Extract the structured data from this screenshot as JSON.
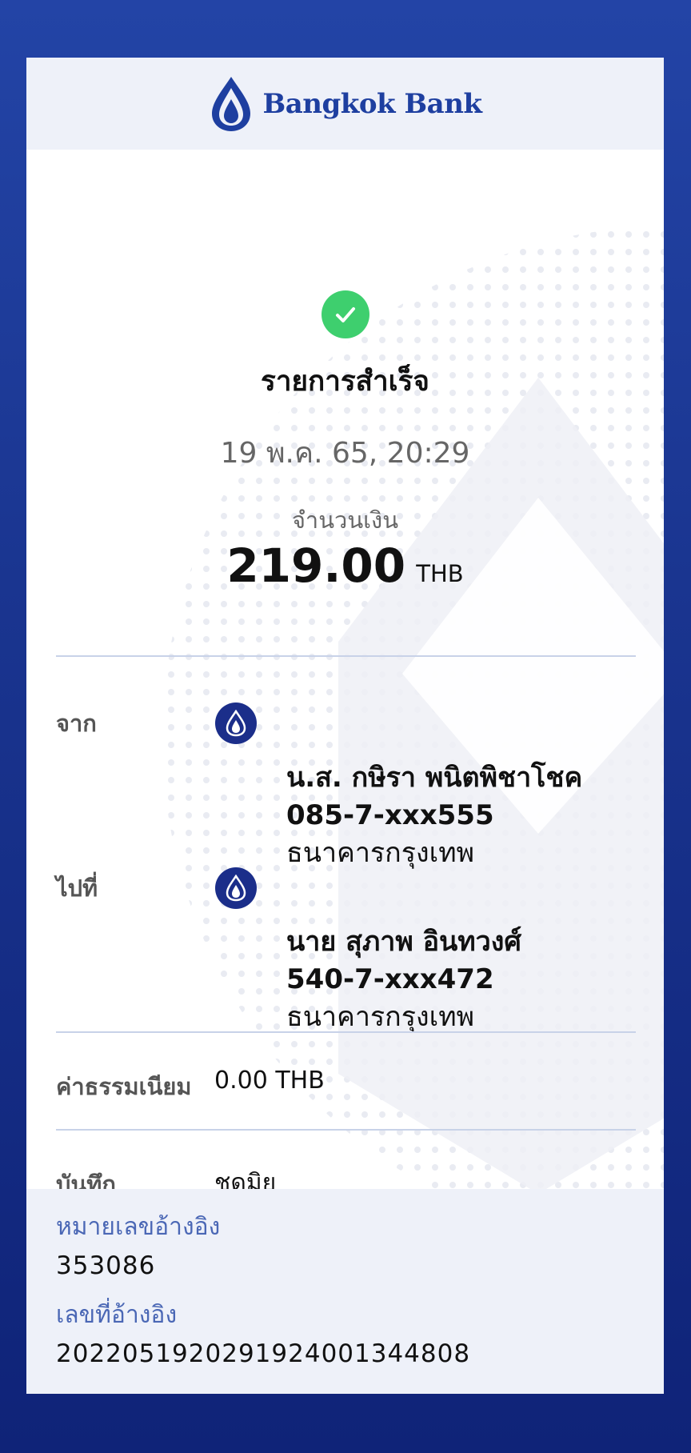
{
  "brand": {
    "name": "Bangkok Bank",
    "logo_icon": "lotus-logo-icon",
    "color": "#1e3fa0"
  },
  "status": {
    "icon": "check-circle-icon",
    "color": "#3ecf6e",
    "title": "รายการสำเร็จ"
  },
  "datetime": "19 พ.ค. 65, 20:29",
  "amount": {
    "label": "จำนวนเงิน",
    "value": "219.00",
    "currency": "THB"
  },
  "from": {
    "label": "จาก",
    "icon": "bangkok-bank-icon",
    "name": "น.ส. กษิรา พนิตพิชาโชค",
    "account": "085-7-xxx555",
    "bank": "ธนาคารกรุงเทพ"
  },
  "to": {
    "label": "ไปที่",
    "icon": "bangkok-bank-icon",
    "name": "นาย สุภาพ อินทวงศ์",
    "account": "540-7-xxx472",
    "bank": "ธนาคารกรุงเทพ"
  },
  "fee": {
    "label": "ค่าธรรมเนียม",
    "value": "0.00 THB"
  },
  "memo": {
    "label": "บันทึก",
    "value": "ชุดมิยู"
  },
  "reference": {
    "ref_label": "หมายเลขอ้างอิง",
    "ref_value": "353086",
    "txn_label": "เลขที่อ้างอิง",
    "txn_value": "2022051920291924001344808"
  }
}
